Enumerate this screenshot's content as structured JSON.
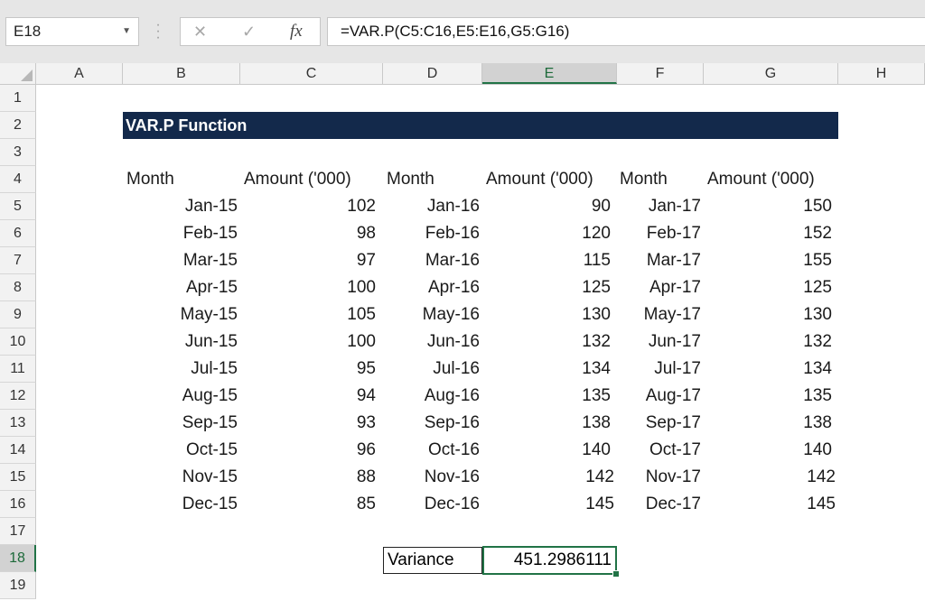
{
  "formula_bar": {
    "name_box": "E18",
    "formula": "=VAR.P(C5:C16,E5:E16,G5:G16)",
    "fx_label": "fx"
  },
  "columns": [
    "A",
    "B",
    "C",
    "D",
    "E",
    "F",
    "G",
    "H"
  ],
  "rows": [
    "1",
    "2",
    "3",
    "4",
    "5",
    "6",
    "7",
    "8",
    "9",
    "10",
    "11",
    "12",
    "13",
    "14",
    "15",
    "16",
    "17",
    "18",
    "19"
  ],
  "sheet": {
    "title": "VAR.P Function",
    "headers": [
      "Month",
      "Amount ('000)",
      "Month",
      "Amount ('000)",
      "Month",
      "Amount ('000)"
    ],
    "data": [
      [
        "Jan-15",
        "102",
        "Jan-16",
        "90",
        "Jan-17",
        "150"
      ],
      [
        "Feb-15",
        "98",
        "Feb-16",
        "120",
        "Feb-17",
        "152"
      ],
      [
        "Mar-15",
        "97",
        "Mar-16",
        "115",
        "Mar-17",
        "155"
      ],
      [
        "Apr-15",
        "100",
        "Apr-16",
        "125",
        "Apr-17",
        "125"
      ],
      [
        "May-15",
        "105",
        "May-16",
        "130",
        "May-17",
        "130"
      ],
      [
        "Jun-15",
        "100",
        "Jun-16",
        "132",
        "Jun-17",
        "132"
      ],
      [
        "Jul-15",
        "95",
        "Jul-16",
        "134",
        "Jul-17",
        "134"
      ],
      [
        "Aug-15",
        "94",
        "Aug-16",
        "135",
        "Aug-17",
        "135"
      ],
      [
        "Sep-15",
        "93",
        "Sep-16",
        "138",
        "Sep-17",
        "138"
      ],
      [
        "Oct-15",
        "96",
        "Oct-16",
        "140",
        "Oct-17",
        "140"
      ],
      [
        "Nov-15",
        "88",
        "Nov-16",
        "142",
        "Nov-17",
        "142"
      ],
      [
        "Dec-15",
        "85",
        "Dec-16",
        "145",
        "Dec-17",
        "145"
      ]
    ],
    "variance_label": "Variance",
    "variance_value": "451.2986111"
  },
  "selection": {
    "active_column": "E",
    "active_row": "18"
  },
  "colors": {
    "title_bg": "#13294b",
    "selection": "#217346"
  }
}
